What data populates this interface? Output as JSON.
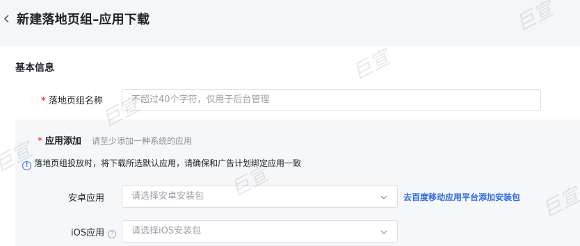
{
  "header": {
    "title": "新建落地页组–应用下载"
  },
  "basic": {
    "section_title": "基本信息",
    "name_label": "落地页组名称",
    "name_placeholder": "不超过40个字符，仅用于后台管理"
  },
  "app_add": {
    "label": "应用添加",
    "hint": "请至少添加一种系统的应用",
    "notice": "落地页组投放时，将下载所选默认应用，请确保和广告计划绑定应用一致",
    "android": {
      "label": "安卓应用",
      "placeholder": "请选择安卓安装包",
      "link": "去百度移动应用平台添加安装包"
    },
    "ios": {
      "label": "iOS应用",
      "placeholder": "请选择iOS安装包"
    }
  },
  "watermark_text": "巨宣",
  "colors": {
    "required": "#e8483f",
    "link": "#2f6be6",
    "panel_bg": "#f6f7f9"
  },
  "icons": [
    "back-icon",
    "info-icon",
    "chevron-down-icon",
    "help-icon"
  ]
}
